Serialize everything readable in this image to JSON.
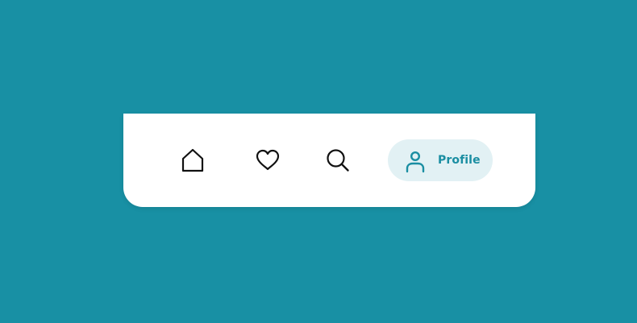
{
  "colors": {
    "background": "#1890a4",
    "card": "#ffffff",
    "active_pill": "#e2f1f4",
    "accent": "#1a8ea2",
    "icon": "#111111"
  },
  "nav": {
    "items": [
      {
        "id": "home",
        "icon": "home-icon",
        "active": false
      },
      {
        "id": "favorites",
        "icon": "heart-icon",
        "active": false
      },
      {
        "id": "search",
        "icon": "search-icon",
        "active": false
      },
      {
        "id": "profile",
        "icon": "user-icon",
        "label": "Profile",
        "active": true
      }
    ]
  }
}
